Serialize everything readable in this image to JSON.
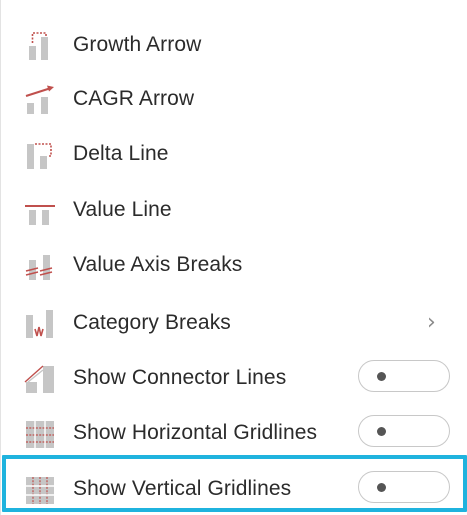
{
  "menu": {
    "items": [
      {
        "label": "Growth Arrow",
        "icon": "growth-arrow-icon"
      },
      {
        "label": "CAGR Arrow",
        "icon": "cagr-arrow-icon"
      },
      {
        "label": "Delta Line",
        "icon": "delta-line-icon"
      },
      {
        "label": "Value Line",
        "icon": "value-line-icon"
      },
      {
        "label": "Value Axis Breaks",
        "icon": "value-axis-breaks-icon"
      },
      {
        "label": "Category Breaks",
        "icon": "category-breaks-icon",
        "submenu_chevron": "›"
      },
      {
        "label": "Show Connector Lines",
        "icon": "connector-lines-icon",
        "toggle_on": false
      },
      {
        "label": "Show Horizontal Gridlines",
        "icon": "horizontal-gridlines-icon",
        "toggle_on": false
      },
      {
        "label": "Show Vertical Gridlines",
        "icon": "vertical-gridlines-icon",
        "toggle_on": false
      }
    ]
  },
  "colors": {
    "accent_red": "#c0504d",
    "icon_gray": "#c6c6c6",
    "selection_border": "#1fb3de",
    "text": "#2b2b2b"
  }
}
